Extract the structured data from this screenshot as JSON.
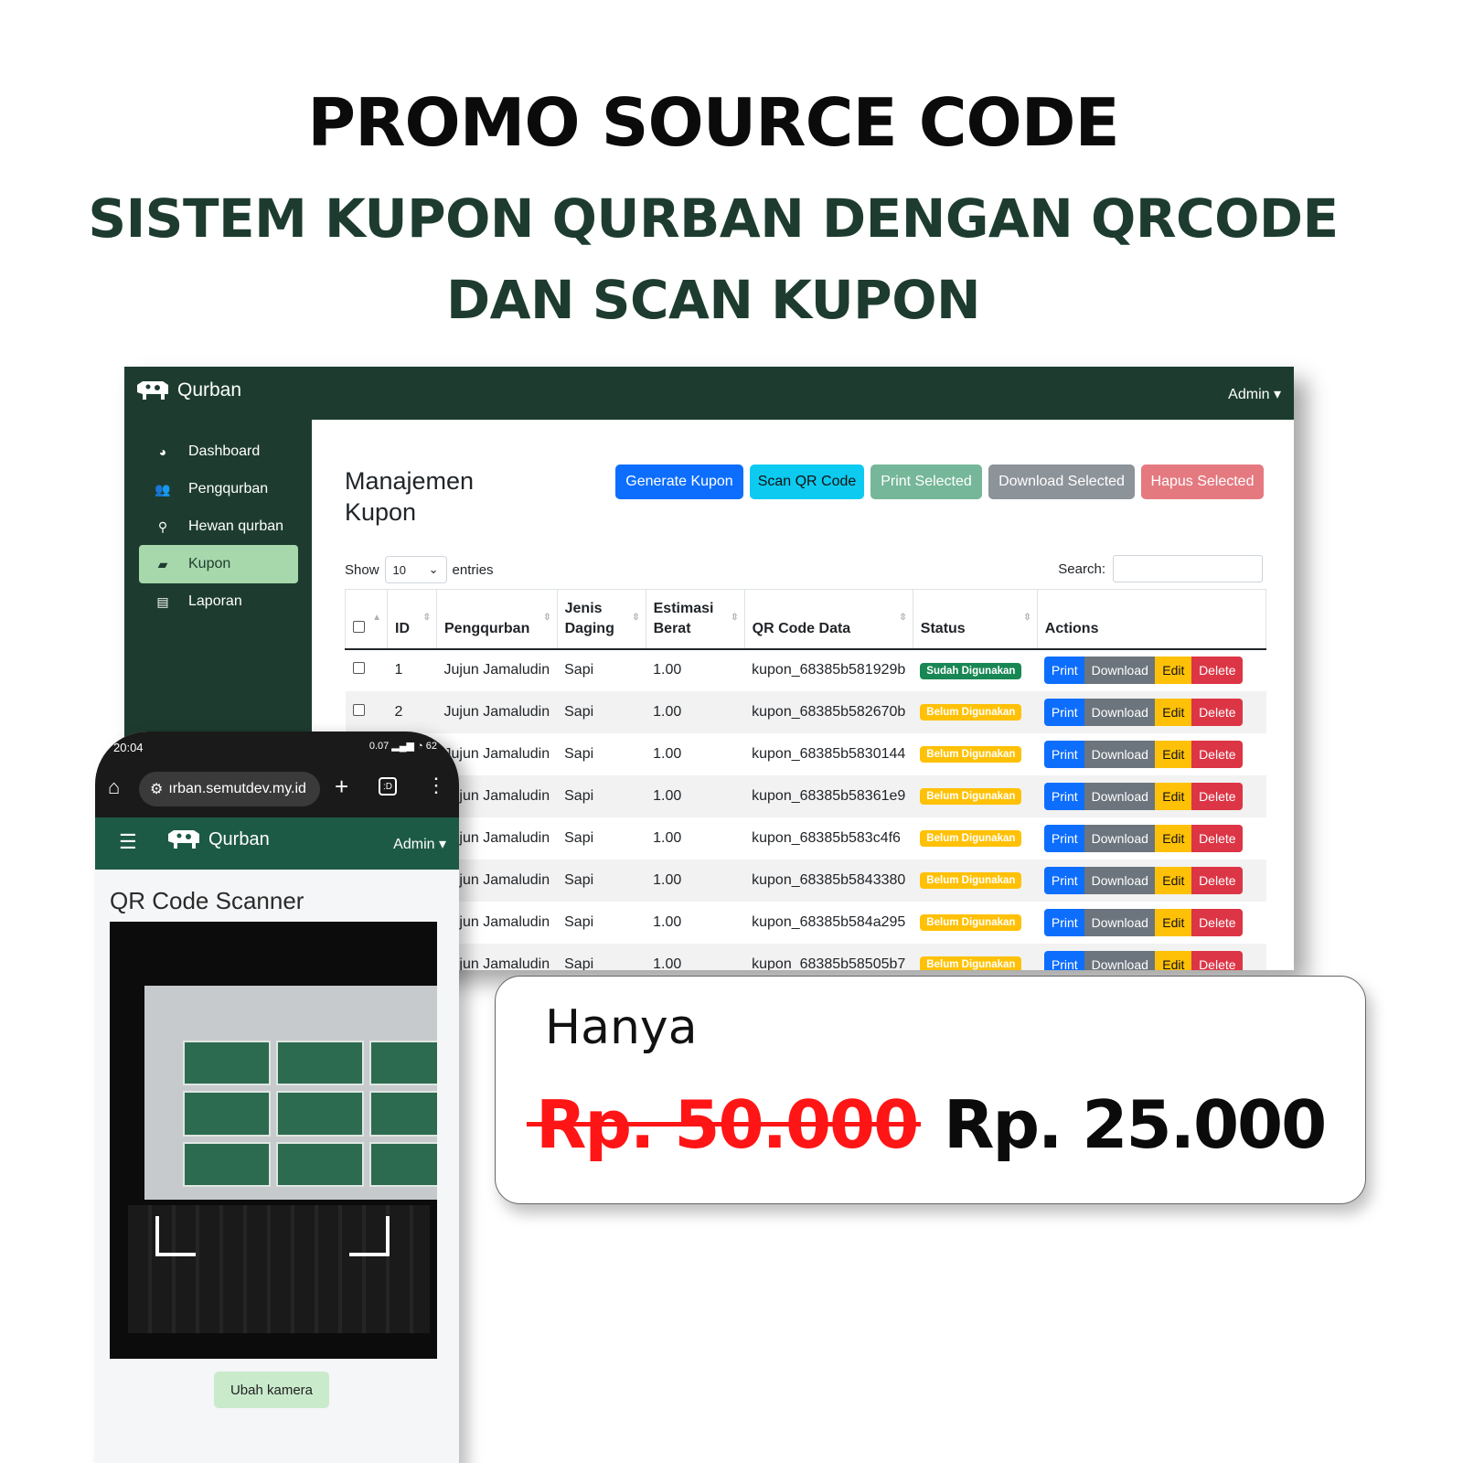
{
  "promo": {
    "title": "PROMO SOURCE CODE",
    "subtitle_line1": "SISTEM KUPON QURBAN DENGAN QRCODE",
    "subtitle_line2": "DAN SCAN KUPON"
  },
  "app": {
    "brand": "Qurban",
    "admin_menu": "Admin ▾"
  },
  "sidebar": {
    "items": [
      {
        "label": "Dashboard",
        "icon": "dashboard-icon"
      },
      {
        "label": "Pengqurban",
        "icon": "users-icon"
      },
      {
        "label": "Hewan qurban",
        "icon": "animal-icon"
      },
      {
        "label": "Kupon",
        "icon": "truck-icon",
        "active": true
      },
      {
        "label": "Laporan",
        "icon": "file-icon"
      }
    ]
  },
  "main": {
    "title": "Manajemen Kupon",
    "buttons": {
      "generate": "Generate Kupon",
      "scan": "Scan QR Code",
      "print_selected": "Print Selected",
      "download_selected": "Download Selected",
      "delete_selected": "Hapus Selected"
    },
    "show_label": "Show",
    "entries_value": "10",
    "entries_label": "entries",
    "search_label": "Search:"
  },
  "table": {
    "columns": [
      "ID",
      "Pengqurban",
      "Jenis Daging",
      "Estimasi Berat",
      "QR Code Data",
      "Status",
      "Actions"
    ],
    "actions": {
      "print": "Print",
      "download": "Download",
      "edit": "Edit",
      "delete": "Delete"
    },
    "rows": [
      {
        "id": "1",
        "name": "Jujun Jamaludin",
        "meat": "Sapi",
        "weight": "1.00",
        "qr": "kupon_68385b581929b",
        "status": "Sudah Digunakan"
      },
      {
        "id": "2",
        "name": "Jujun Jamaludin",
        "meat": "Sapi",
        "weight": "1.00",
        "qr": "kupon_68385b582670b",
        "status": "Belum Digunakan"
      },
      {
        "id": "",
        "name": "Jujun Jamaludin",
        "meat": "Sapi",
        "weight": "1.00",
        "qr": "kupon_68385b5830144",
        "status": "Belum Digunakan"
      },
      {
        "id": "",
        "name": "Jujun Jamaludin",
        "meat": "Sapi",
        "weight": "1.00",
        "qr": "kupon_68385b58361e9",
        "status": "Belum Digunakan"
      },
      {
        "id": "",
        "name": "Jujun Jamaludin",
        "meat": "Sapi",
        "weight": "1.00",
        "qr": "kupon_68385b583c4f6",
        "status": "Belum Digunakan"
      },
      {
        "id": "",
        "name": "Jujun Jamaludin",
        "meat": "Sapi",
        "weight": "1.00",
        "qr": "kupon_68385b5843380",
        "status": "Belum Digunakan"
      },
      {
        "id": "",
        "name": "Jujun Jamaludin",
        "meat": "Sapi",
        "weight": "1.00",
        "qr": "kupon_68385b584a295",
        "status": "Belum Digunakan"
      },
      {
        "id": "",
        "name": "Jujun Jamaludin",
        "meat": "Sapi",
        "weight": "1.00",
        "qr": "kupon_68385b58505b7",
        "status": "Belum Digunakan"
      }
    ]
  },
  "phone": {
    "time": "20:04",
    "status_right": "0.07 ▂▄▆ ◔ 62",
    "url": "ırban.semutdev.my.id",
    "brand": "Qurban",
    "admin": "Admin ▾",
    "heading": "QR Code Scanner",
    "switch_camera": "Ubah kamera"
  },
  "price": {
    "label": "Hanya",
    "old": "Rp. 50.000",
    "new": "Rp. 25.000"
  },
  "colors": {
    "brand_dark": "#1d3c2f",
    "active_item": "#a7d8ac",
    "price_old": "#ff1515"
  }
}
